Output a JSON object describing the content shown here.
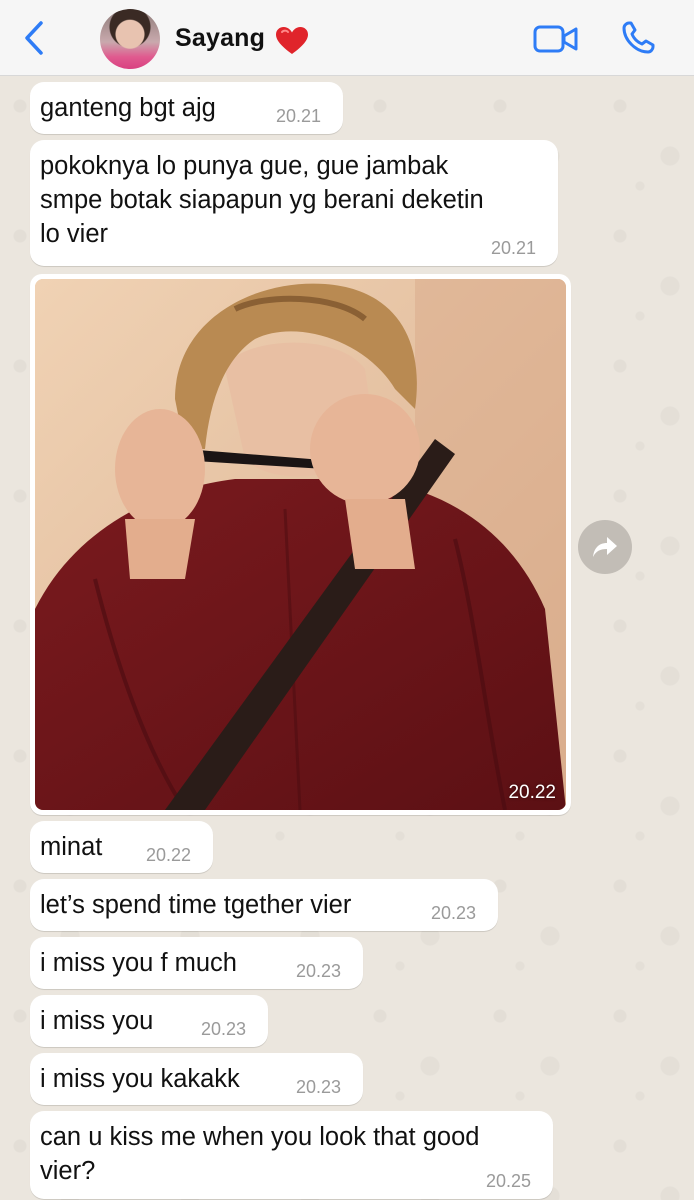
{
  "header": {
    "contact_name": "Sayang",
    "accent_color": "#2e7cf6"
  },
  "messages": [
    {
      "text": "ganteng bgt ajg",
      "time": "20.21"
    },
    {
      "text": "pokoknya lo punya gue, gue jambak\nsmpe botak siapapun yg berani deketin\nlo vier",
      "time": "20.21"
    },
    {
      "type": "photo",
      "time": "20.22"
    },
    {
      "text": "minat",
      "time": "20.22"
    },
    {
      "text": "let’s spend time tgether vier",
      "time": "20.23"
    },
    {
      "text": "i miss you f much",
      "time": "20.23"
    },
    {
      "text": "i miss you",
      "time": "20.23"
    },
    {
      "text": "i miss you kakakk",
      "time": "20.23"
    },
    {
      "text": "can u kiss me when you look that good\nvier?",
      "time": "20.25"
    }
  ]
}
